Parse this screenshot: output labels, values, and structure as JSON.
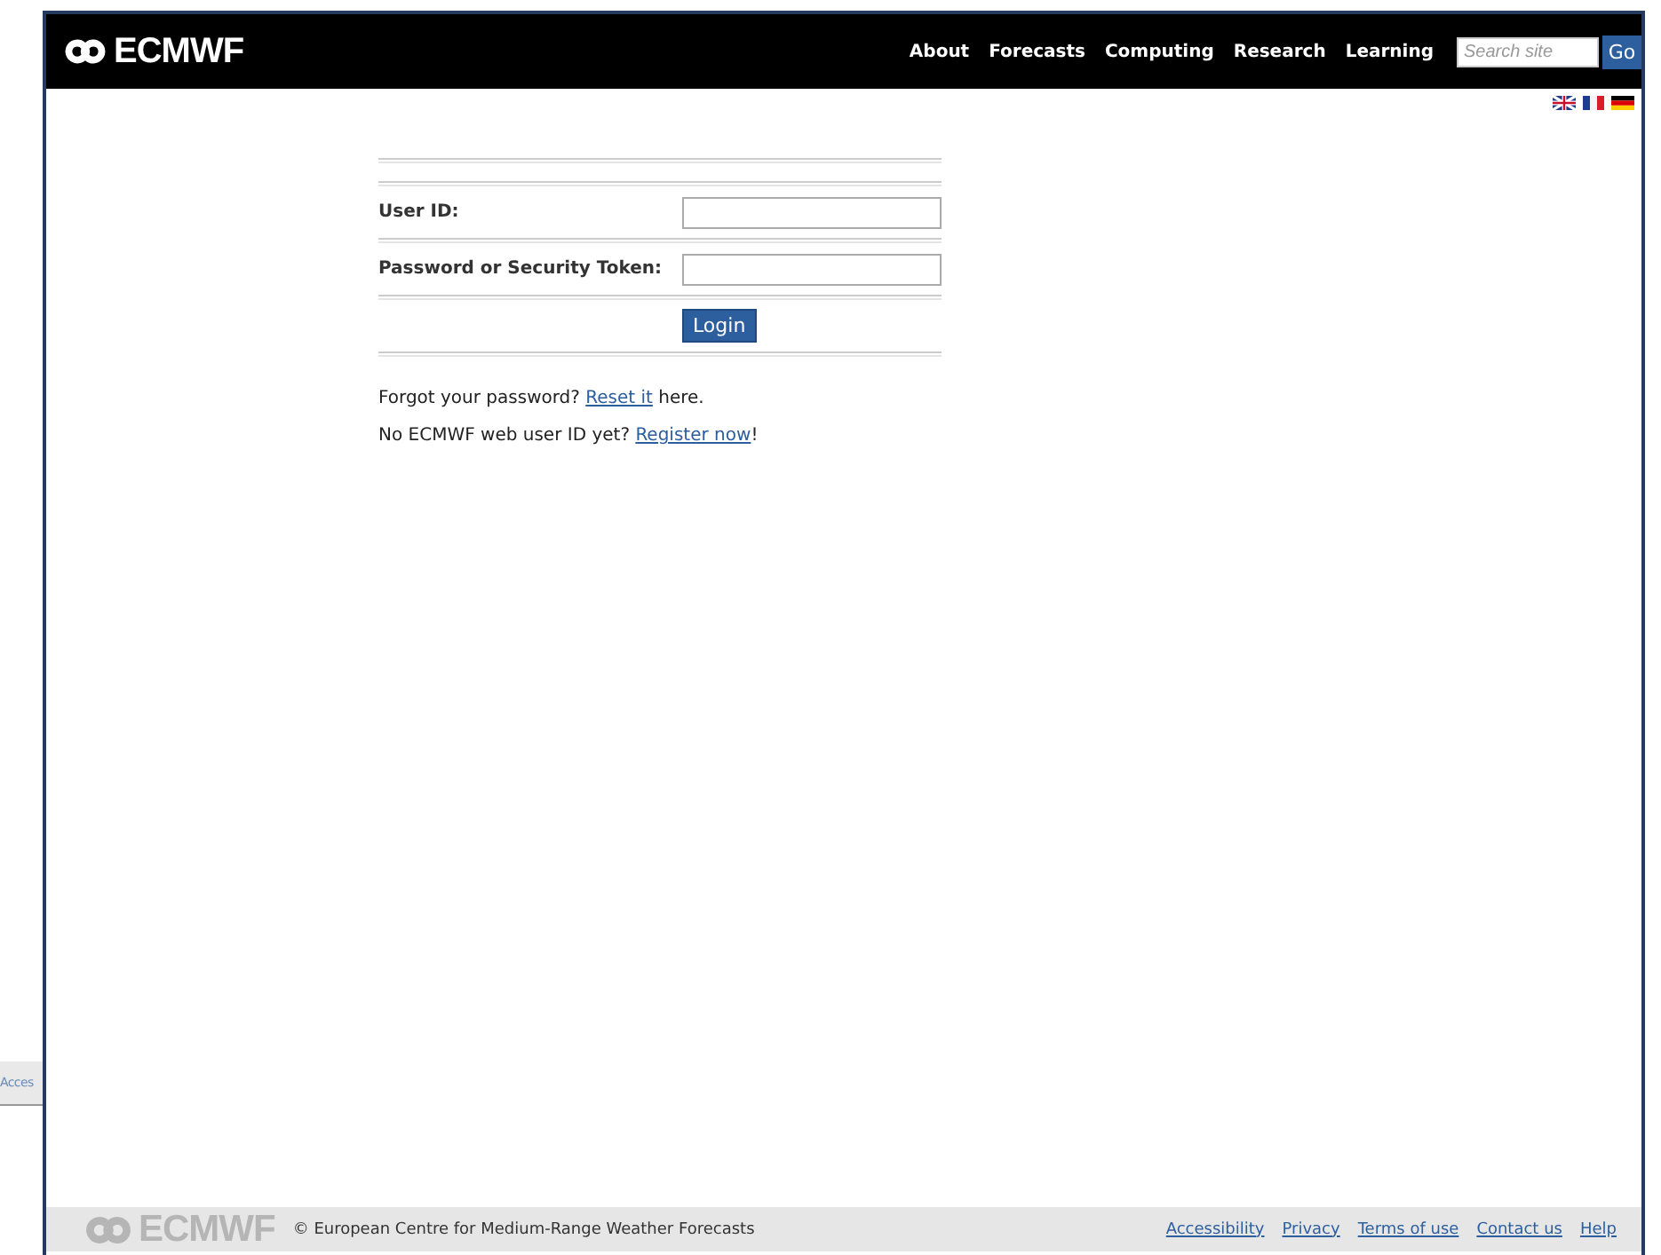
{
  "side_tab": {
    "label": "Acces"
  },
  "header": {
    "logo": "ECMWF",
    "nav": [
      "About",
      "Forecasts",
      "Computing",
      "Research",
      "Learning"
    ],
    "search": {
      "placeholder": "Search site"
    },
    "go_button": "Go"
  },
  "languages": [
    {
      "kind": "uk"
    },
    {
      "kind": "fr"
    },
    {
      "kind": "de"
    }
  ],
  "form": {
    "fields": [
      {
        "label": "User ID:"
      },
      {
        "label": "Password or Security Token:"
      }
    ],
    "submit": "Login"
  },
  "notes": [
    {
      "before": "Forgot your password? ",
      "link": "Reset it",
      "after": " here."
    },
    {
      "before": "No ECMWF web user ID yet? ",
      "link": "Register now",
      "after": "!"
    }
  ],
  "footer": {
    "logo": "ECMWF",
    "copyright": "© European Centre for Medium-Range Weather Forecasts",
    "links": [
      "Accessibility",
      "Privacy",
      "Terms of use",
      "Contact us",
      "Help"
    ]
  }
}
